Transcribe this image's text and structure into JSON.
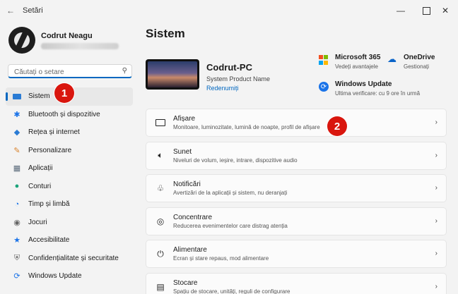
{
  "window": {
    "title": "Setări",
    "back_icon": "back-arrow-icon"
  },
  "profile": {
    "name": "Codrut Neagu"
  },
  "search": {
    "placeholder": "Căutați o setare"
  },
  "sidebar": {
    "items": [
      {
        "label": "Sistem",
        "icon": "monitor-icon",
        "active": true
      },
      {
        "label": "Bluetooth și dispozitive",
        "icon": "bluetooth-icon"
      },
      {
        "label": "Rețea și internet",
        "icon": "wifi-icon"
      },
      {
        "label": "Personalizare",
        "icon": "brush-icon"
      },
      {
        "label": "Aplicații",
        "icon": "apps-icon"
      },
      {
        "label": "Conturi",
        "icon": "person-icon"
      },
      {
        "label": "Timp și limbă",
        "icon": "globe-clock-icon"
      },
      {
        "label": "Jocuri",
        "icon": "gamepad-icon"
      },
      {
        "label": "Accesibilitate",
        "icon": "accessibility-icon"
      },
      {
        "label": "Confidențialitate și securitate",
        "icon": "shield-icon"
      },
      {
        "label": "Windows Update",
        "icon": "update-icon"
      }
    ]
  },
  "main": {
    "title": "Sistem",
    "device": {
      "name": "Codrut-PC",
      "model": "System Product Name",
      "rename": "Redenumiți"
    },
    "services": {
      "m365": {
        "title": "Microsoft 365",
        "sub": "Vedeți avantajele"
      },
      "onedrive": {
        "title": "OneDrive",
        "sub": "Gestionați"
      },
      "update": {
        "title": "Windows Update",
        "sub": "Ultima verificare: cu 9 ore în urmă"
      }
    },
    "cards": [
      {
        "title": "Afișare",
        "sub": "Monitoare, luminozitate, lumină de noapte, profil de afișare",
        "icon": "display-icon"
      },
      {
        "title": "Sunet",
        "sub": "Niveluri de volum, ieșire, intrare, dispozitive audio",
        "icon": "speaker-icon"
      },
      {
        "title": "Notificări",
        "sub": "Avertizări de la aplicații și sistem, nu deranjați",
        "icon": "bell-icon"
      },
      {
        "title": "Concentrare",
        "sub": "Reducerea evenimentelor care distrag atenția",
        "icon": "focus-icon"
      },
      {
        "title": "Alimentare",
        "sub": "Ecran și stare repaus, mod alimentare",
        "icon": "power-icon"
      },
      {
        "title": "Stocare",
        "sub": "Spațiu de stocare, unități, reguli de configurare",
        "icon": "storage-icon"
      }
    ]
  },
  "annotations": {
    "first": "1",
    "second": "2"
  },
  "colors": {
    "accent": "#0067c0",
    "badge": "#d9160e"
  }
}
